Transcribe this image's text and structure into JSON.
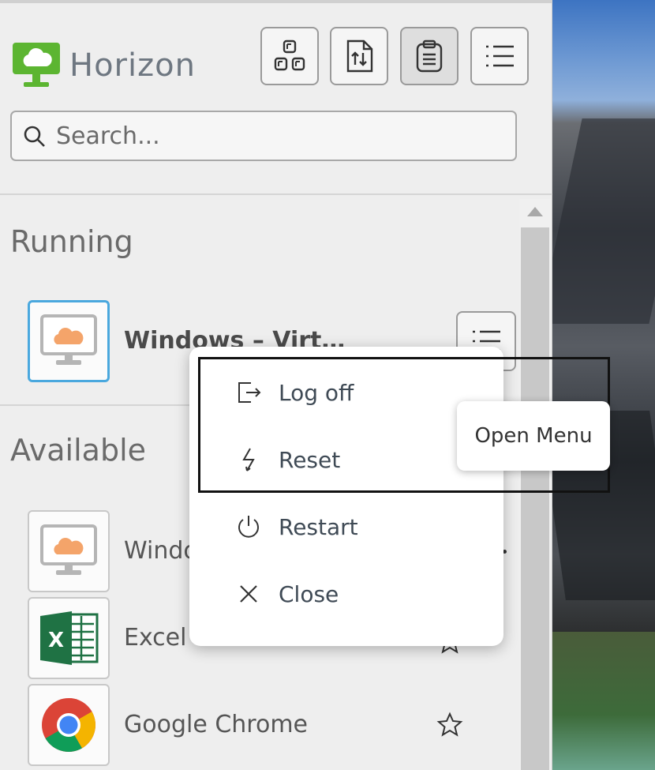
{
  "header": {
    "brand": "Horizon",
    "toolbar": [
      {
        "name": "apps-view-button",
        "icon": "apps-grid-icon"
      },
      {
        "name": "file-transfer-button",
        "icon": "file-transfer-icon"
      },
      {
        "name": "clipboard-button",
        "icon": "clipboard-icon"
      },
      {
        "name": "list-menu-button",
        "icon": "list-icon"
      }
    ]
  },
  "search": {
    "placeholder": "Search..."
  },
  "running": {
    "title": "Running",
    "items": [
      {
        "label": "Windows – Virt…",
        "icon": "cloud-desktop-icon"
      }
    ]
  },
  "available": {
    "title": "Available",
    "items": [
      {
        "label": "Windo",
        "icon": "cloud-desktop-icon"
      },
      {
        "label": "Excel",
        "icon": "excel-icon"
      },
      {
        "label": "Google Chrome",
        "icon": "chrome-icon"
      }
    ]
  },
  "context_menu": {
    "items": [
      {
        "label": "Log off",
        "icon": "logoff-icon"
      },
      {
        "label": "Reset",
        "icon": "reset-icon"
      },
      {
        "label": "Restart",
        "icon": "power-icon"
      },
      {
        "label": "Close",
        "icon": "close-icon"
      }
    ]
  },
  "tooltip": {
    "text": "Open Menu"
  },
  "colors": {
    "brand_green": "#5cb531",
    "selected_border": "#4aa8de",
    "cloud_orange": "#f4a46a"
  }
}
